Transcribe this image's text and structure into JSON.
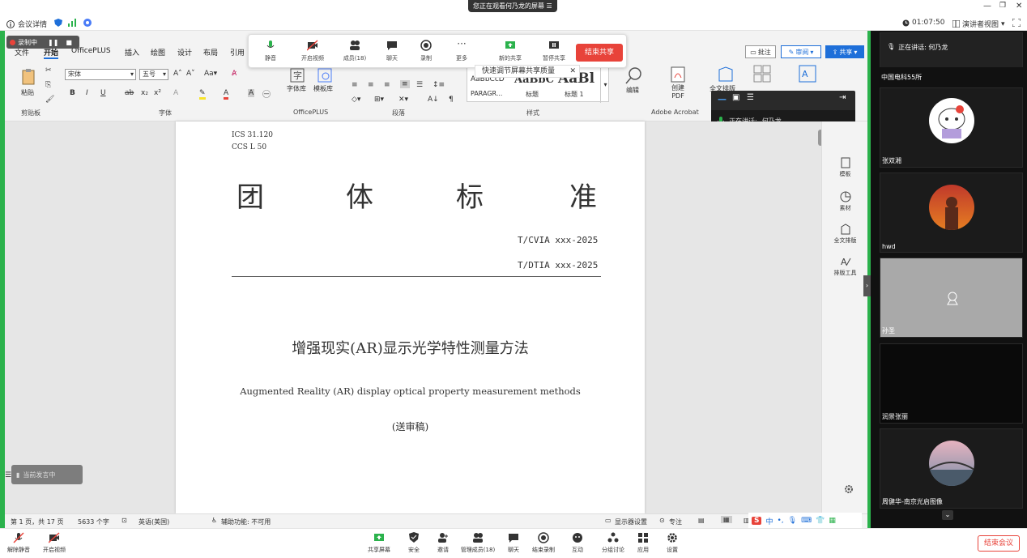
{
  "meeting": {
    "details_label": "会议详情",
    "viewing_banner": "您正在观看何乃龙的屏幕",
    "timer": "01:07:50",
    "view_label": "演讲者视图"
  },
  "share_toolbar": {
    "recording_label": "录制中",
    "items": [
      "静音",
      "开启视频",
      "成员(18)",
      "聊天",
      "录制",
      "更多",
      "新的共享",
      "暂停共享"
    ],
    "end_share": "结束共享",
    "quality_tip": "快速调节屏幕共享质量"
  },
  "ribbon": {
    "tabs": [
      "文件",
      "开始",
      "OfficePLUS",
      "插入",
      "绘图",
      "设计",
      "布局",
      "引用"
    ],
    "right_buttons": [
      "批注",
      "审阅",
      "共享"
    ],
    "font_name": "宋体",
    "font_size": "五号",
    "paste_label": "粘贴",
    "groups": [
      "剪贴板",
      "字体",
      "OfficePLUS",
      "段落",
      "样式",
      "Adobe Acrobat"
    ],
    "officeplus_items": [
      "字体库",
      "模板库"
    ],
    "styles": [
      {
        "preview": "AaBbCcD",
        "name": "PARAGR..."
      },
      {
        "preview": "AaBbC",
        "name": "标题"
      },
      {
        "preview": "AaBl",
        "name": "标题 1"
      }
    ],
    "edit_label": "编辑",
    "pdf_label": "创建 PDF",
    "fulltext_label": "全文排版"
  },
  "speaker_panel": {
    "label": "正在讲话:",
    "name": "何乃龙"
  },
  "right_panel": {
    "items": [
      "模板",
      "素材",
      "全文排版",
      "排版工具"
    ]
  },
  "document": {
    "ics": "ICS 31.120",
    "ccs": "CCS L 50",
    "title_chars": [
      "团",
      "体",
      "标",
      "准"
    ],
    "code1": "T/CVIA xxx-2025",
    "code2": "T/DTIA xxx-2025",
    "zh_title": "增强现实(AR)显示光学特性测量方法",
    "en_title": "Augmented Reality (AR) display optical property measurement methods",
    "draft": "(送审稿)"
  },
  "statusbar": {
    "page": "第 1 页，共 17 页",
    "words": "5633 个字",
    "lang": "英语(美国)",
    "accessibility": "辅助功能: 不可用",
    "display_settings": "显示器设置",
    "focus": "专注"
  },
  "speaking_toast": "当前发言中",
  "participants": [
    {
      "name": "正在讲话: 何乃龙"
    },
    {
      "name": "中国电科55所"
    },
    {
      "name": "张双湘"
    },
    {
      "name": "hwd"
    },
    {
      "name": "孙圣"
    },
    {
      "name": "润景张丽"
    },
    {
      "name": "周健华-南京光启图像"
    }
  ],
  "bottom_bar": {
    "left": [
      "解除静音",
      "开启视频"
    ],
    "center": [
      "共享屏幕",
      "安全",
      "邀请",
      "管理成员(18)",
      "聊天",
      "结束录制",
      "互动",
      "分组讨论",
      "应用",
      "设置"
    ],
    "end_meeting": "结束会议"
  },
  "colors": {
    "share_border": "#2bb24c",
    "end_red": "#e8433a",
    "blue": "#1e6fd9"
  }
}
